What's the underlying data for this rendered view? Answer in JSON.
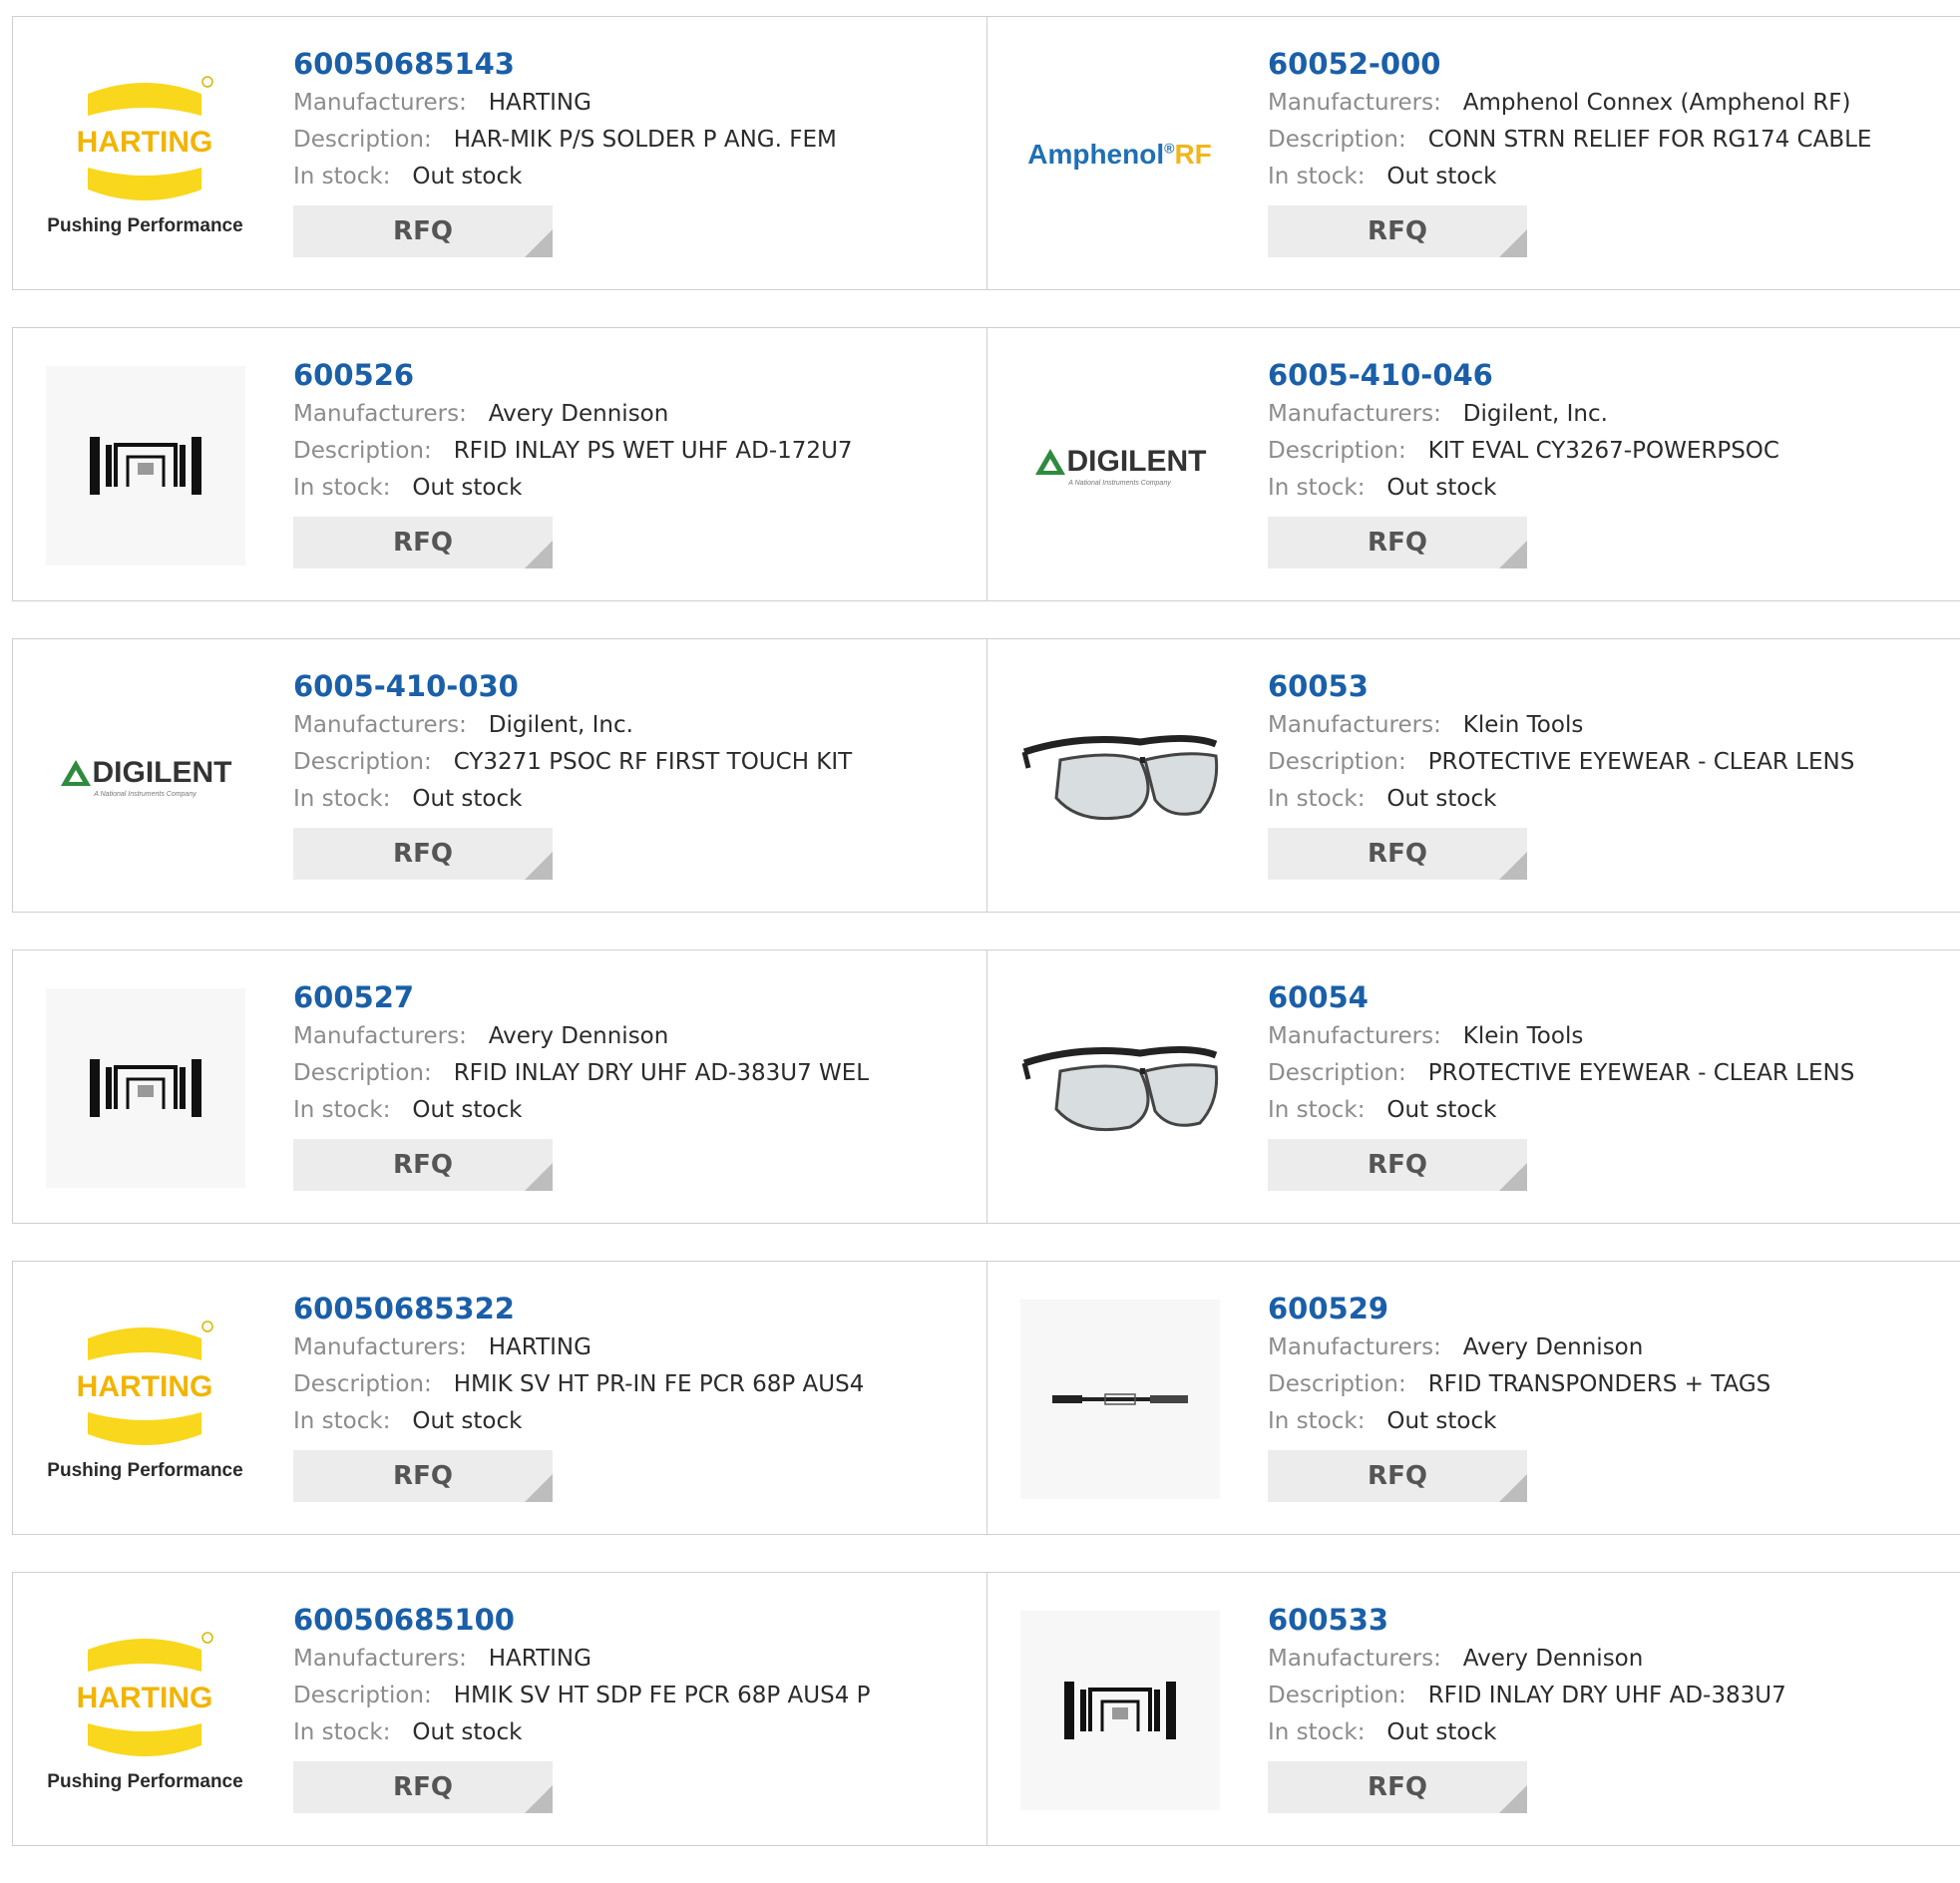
{
  "labels": {
    "manufacturers": "Manufacturers:",
    "description": "Description:",
    "in_stock": "In stock:",
    "rfq": "RFQ"
  },
  "logos": {
    "harting_word": "HARTING",
    "harting_tagline": "Pushing Performance",
    "amphenol_word": "Amphenol",
    "amphenol_mark": "®",
    "amphenol_rf": "RF",
    "digilent_word": "DIGILENT",
    "digilent_tagline": "A National Instruments Company"
  },
  "colors": {
    "part_link": "#1a5fa8",
    "harting_yellow": "#f9d71c",
    "amphenol_blue": "#1f6fb4",
    "amphenol_rf": "#f2b51e",
    "digilent_green": "#2e8b3e"
  },
  "products": [
    {
      "part": "60050685143",
      "manufacturer": "HARTING",
      "description": "HAR-MIK P/S SOLDER P ANG. FEM",
      "stock": "Out stock",
      "logo": "harting-logo"
    },
    {
      "part": "60052-000",
      "manufacturer": "Amphenol Connex (Amphenol RF)",
      "description": "CONN STRN RELIEF FOR RG174 CABLE",
      "stock": "Out stock",
      "logo": "amphenol-rf-logo"
    },
    {
      "part": "600526",
      "manufacturer": "Avery Dennison",
      "description": "RFID INLAY PS WET UHF AD-172U7",
      "stock": "Out stock",
      "logo": "rfid-inlay-image"
    },
    {
      "part": "6005-410-046",
      "manufacturer": "Digilent, Inc.",
      "description": "KIT EVAL CY3267-POWERPSOC",
      "stock": "Out stock",
      "logo": "digilent-logo"
    },
    {
      "part": "6005-410-030",
      "manufacturer": "Digilent, Inc.",
      "description": "CY3271 PSOC RF FIRST TOUCH KIT",
      "stock": "Out stock",
      "logo": "digilent-logo"
    },
    {
      "part": "60053",
      "manufacturer": "Klein Tools",
      "description": "PROTECTIVE EYEWEAR - CLEAR LENS",
      "stock": "Out stock",
      "logo": "safety-glasses-image"
    },
    {
      "part": "600527",
      "manufacturer": "Avery Dennison",
      "description": "RFID INLAY DRY UHF AD-383U7 WEL",
      "stock": "Out stock",
      "logo": "rfid-inlay-image"
    },
    {
      "part": "60054",
      "manufacturer": "Klein Tools",
      "description": "PROTECTIVE EYEWEAR - CLEAR LENS",
      "stock": "Out stock",
      "logo": "safety-glasses-image"
    },
    {
      "part": "60050685322",
      "manufacturer": "HARTING",
      "description": "HMIK SV HT PR-IN FE PCR 68P AUS4",
      "stock": "Out stock",
      "logo": "harting-logo"
    },
    {
      "part": "600529",
      "manufacturer": "Avery Dennison",
      "description": "RFID TRANSPONDERS + TAGS",
      "stock": "Out stock",
      "logo": "rfid-strip-image"
    },
    {
      "part": "60050685100",
      "manufacturer": "HARTING",
      "description": "HMIK SV HT SDP FE PCR 68P AUS4 P",
      "stock": "Out stock",
      "logo": "harting-logo"
    },
    {
      "part": "600533",
      "manufacturer": "Avery Dennison",
      "description": "RFID INLAY DRY UHF AD-383U7",
      "stock": "Out stock",
      "logo": "rfid-inlay-image"
    }
  ]
}
